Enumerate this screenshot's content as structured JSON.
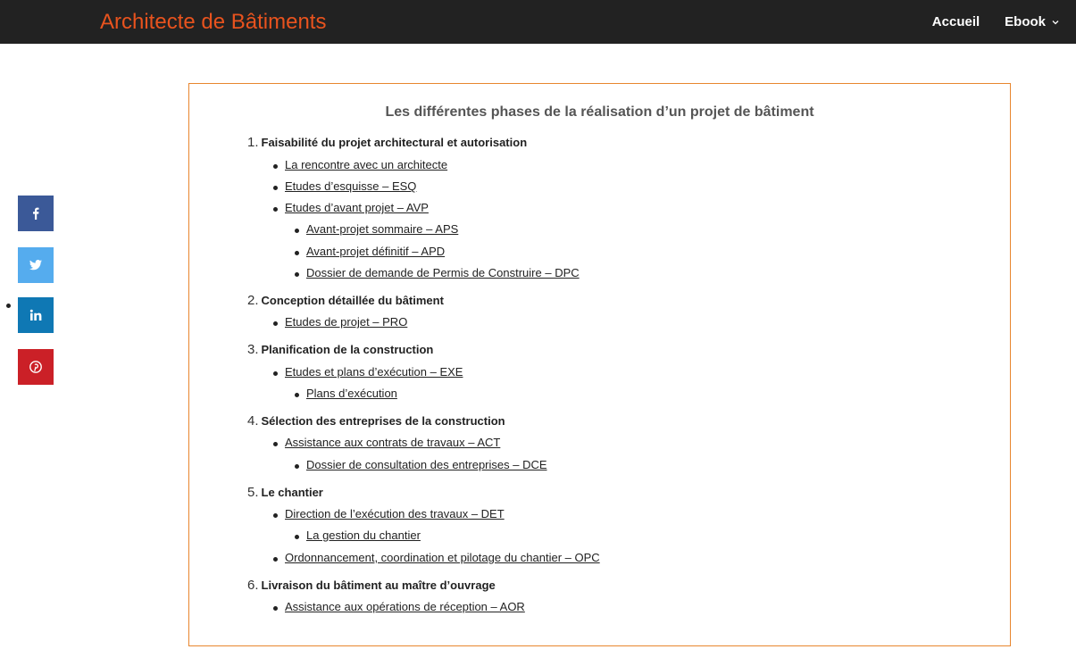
{
  "header": {
    "site_title": "Architecte de Bâtiments",
    "nav": [
      {
        "label": "Accueil"
      },
      {
        "label": "Ebook"
      }
    ]
  },
  "share_icons": [
    "facebook-icon",
    "twitter-icon",
    "linkedin-icon",
    "pinterest-icon"
  ],
  "colors": {
    "accent": "#e8531e",
    "header_bg": "#222222",
    "box_border": "#e8862e",
    "facebook": "#3b5998",
    "twitter": "#55acee",
    "linkedin": "#0f78b4",
    "pinterest": "#cb2027"
  },
  "toc": {
    "title": "Les différentes phases de la réalisation d’un projet de bâtiment",
    "sections": [
      {
        "number": "1.",
        "title": "Faisabilité du projet architectural et autorisation",
        "items": [
          "La rencontre avec un architecte",
          "Etudes d’esquisse – ESQ",
          "Etudes d’avant projet – AVP",
          "Avant-projet sommaire – APS",
          "Avant-projet définitif – APD",
          "Dossier de demande de Permis de Construire – DPC"
        ]
      },
      {
        "number": "2.",
        "title": "Conception détaillée du bâtiment",
        "items": [
          "Etudes de projet – PRO"
        ]
      },
      {
        "number": "3.",
        "title": "Planification de la construction",
        "items": [
          "Etudes et plans d’exécution – EXE",
          "Plans d’exécution"
        ]
      },
      {
        "number": "4.",
        "title": "Sélection des entreprises de la construction",
        "items": [
          "Assistance aux contrats de travaux – ACT",
          "Dossier de consultation des entreprises – DCE"
        ]
      },
      {
        "number": "5.",
        "title": "Le chantier",
        "items": [
          "Direction de l’exécution des travaux – DET",
          "La gestion du chantier",
          "Ordonnancement, coordination et pilotage du chantier – OPC"
        ]
      },
      {
        "number": "6.",
        "title": "Livraison du bâtiment au maître d’ouvrage",
        "items": [
          "Assistance aux opérations de réception – AOR"
        ]
      }
    ]
  }
}
